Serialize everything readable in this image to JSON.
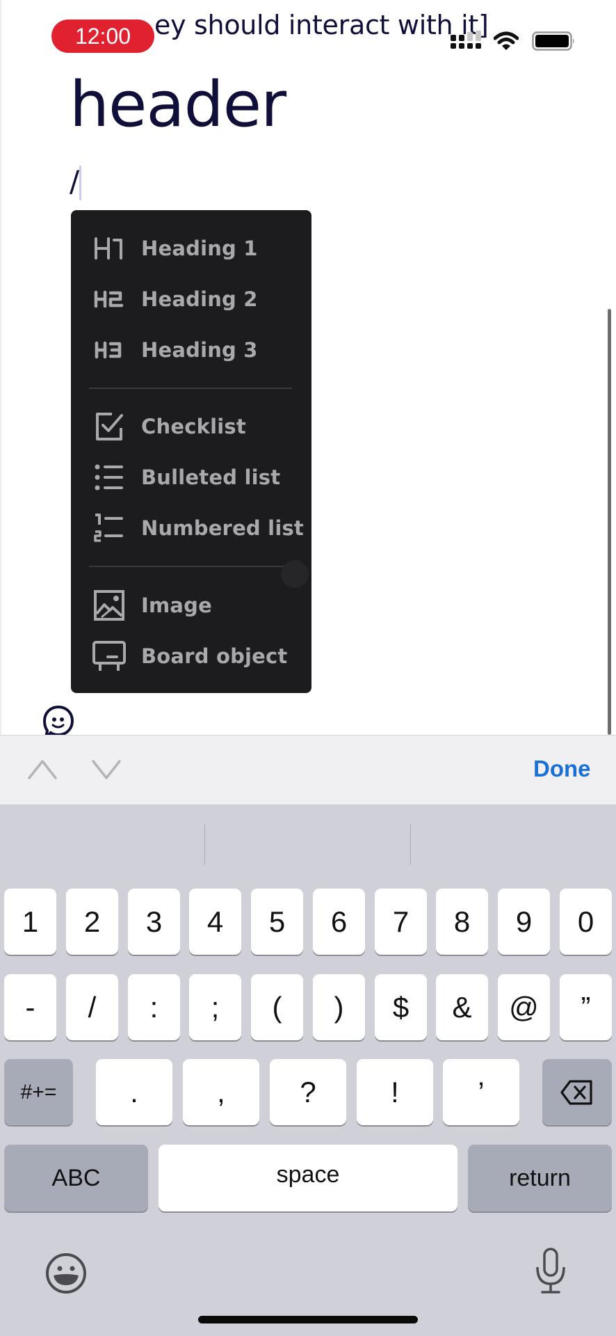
{
  "status_bar": {
    "time": "12:00",
    "signal": "cellular-signal-icon",
    "wifi": "wifi-icon",
    "battery": "battery-icon"
  },
  "document": {
    "previous_line_text": "ey should interact with it]",
    "heading": "header",
    "current_line_text": "/"
  },
  "slash_menu": {
    "groups": [
      [
        {
          "icon": "heading-1-icon",
          "icon_text": "H1",
          "label": "Heading 1"
        },
        {
          "icon": "heading-2-icon",
          "icon_text": "H2",
          "label": "Heading 2"
        },
        {
          "icon": "heading-3-icon",
          "icon_text": "H3",
          "label": "Heading 3"
        }
      ],
      [
        {
          "icon": "checklist-icon",
          "label": "Checklist"
        },
        {
          "icon": "bulleted-list-icon",
          "label": "Bulleted list"
        },
        {
          "icon": "numbered-list-icon",
          "label": "Numbered list"
        }
      ],
      [
        {
          "icon": "image-icon",
          "label": "Image"
        },
        {
          "icon": "board-object-icon",
          "label": "Board object"
        }
      ]
    ],
    "colors": {
      "background": "#1c1b1e",
      "text": "#a9a9ab"
    }
  },
  "toolbar": {
    "prev_icon": "chevron-up-icon",
    "next_icon": "chevron-down-icon",
    "done_label": "Done",
    "done_color": "#1a6fd8"
  },
  "keyboard": {
    "row1": [
      "1",
      "2",
      "3",
      "4",
      "5",
      "6",
      "7",
      "8",
      "9",
      "0"
    ],
    "row2": [
      "-",
      "/",
      ":",
      ";",
      "(",
      ")",
      "$",
      "&",
      "@",
      "”"
    ],
    "row3": {
      "shift_label": "#+=",
      "keys": [
        ".",
        ",",
        "?",
        "!",
        "’"
      ],
      "delete_icon": "delete-backspace-icon"
    },
    "row4": {
      "abc_label": "ABC",
      "space_label": "space",
      "return_label": "return"
    },
    "emoji_icon": "emoji-keyboard-icon",
    "mic_icon": "microphone-icon"
  }
}
